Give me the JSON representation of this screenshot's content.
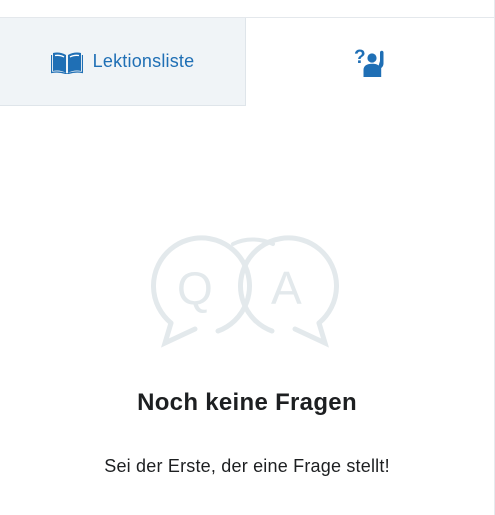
{
  "tabs": {
    "lessons": {
      "label": "Lektionsliste",
      "icon": "open-book-icon"
    },
    "questions": {
      "icon": "raise-hand-question-icon"
    }
  },
  "empty_state": {
    "illustration": "qa-speech-bubbles-icon",
    "title": "Noch keine Fragen",
    "subtitle": "Sei der Erste, der eine Frage stellt!",
    "illustration_letters": [
      "Q",
      "A"
    ]
  },
  "colors": {
    "accent": "#1f6fb5",
    "tab_inactive_bg": "#f0f4f7",
    "illustration": "#e3e9ec",
    "text": "#1d1f21"
  }
}
